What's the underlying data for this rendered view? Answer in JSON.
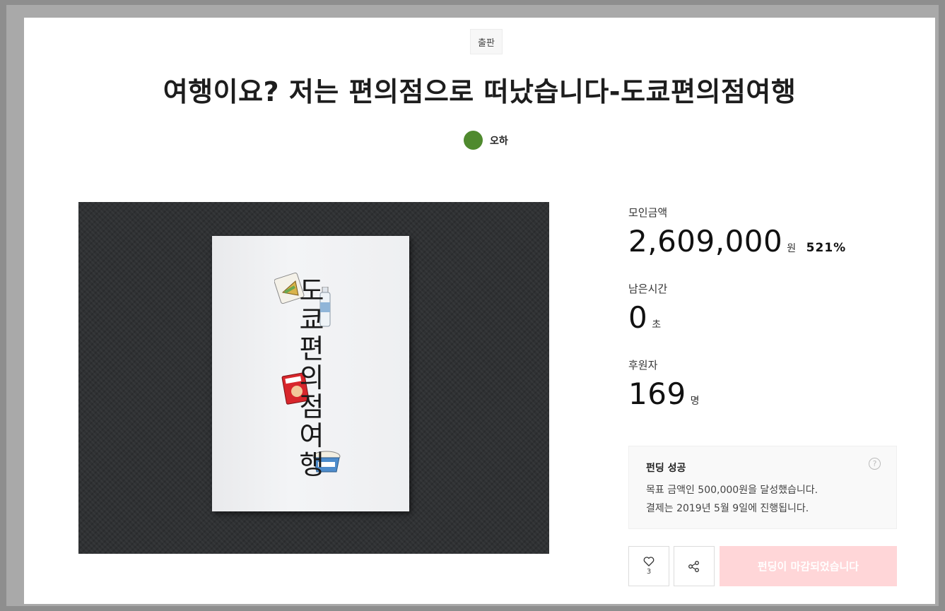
{
  "project": {
    "category": "출판",
    "title": "여행이요? 저는 편의점으로 떠났습니다-도쿄편의점여행",
    "creator_name": "오하",
    "creator_avatar_color": "#4f8a2e",
    "cover_book_title": "도쿄편의점여행"
  },
  "stats": {
    "amount_label": "모인금액",
    "amount_value": "2,609,000",
    "amount_unit": "원",
    "amount_percent": "521%",
    "time_label": "남은시간",
    "time_value": "0",
    "time_unit": "초",
    "backers_label": "후원자",
    "backers_value": "169",
    "backers_unit": "명"
  },
  "result": {
    "heading": "펀딩 성공",
    "help_icon": "?",
    "line1": "목표 금액인 500,000원을 달성했습니다.",
    "line2": "결제는 2019년 5월 9일에 진행됩니다."
  },
  "actions": {
    "like_count": "3",
    "closed_label": "펀딩이 마감되었습니다",
    "closed_color": "#ffd6d8"
  }
}
